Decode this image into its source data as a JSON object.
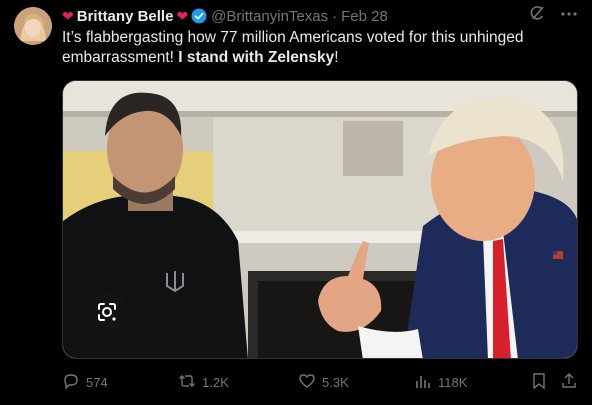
{
  "author": {
    "display_name": "Brittany Belle",
    "handle": "@BrittanyinTexas",
    "date": "Feb 28",
    "verified": true
  },
  "tweet": {
    "text_before": "It’s flabbergasting how 77 million Americans voted for this unhinged embarrassment! ",
    "text_bold": "I stand with Zelensky",
    "text_after": "!"
  },
  "actions": {
    "replies": "574",
    "reposts": "1.2K",
    "likes": "5.3K",
    "views": "118K"
  },
  "colors": {
    "background": "#000000",
    "text": "#e7e9ea",
    "muted": "#71767b",
    "verified_badge": "#1d9bf0",
    "heart": "#e0245e"
  },
  "icons": {
    "grok": "grok-icon",
    "more": "more-icon",
    "reply": "reply-icon",
    "repost": "repost-icon",
    "like": "like-icon",
    "views": "views-icon",
    "bookmark": "bookmark-icon",
    "share": "share-icon",
    "lens": "lens-icon"
  }
}
